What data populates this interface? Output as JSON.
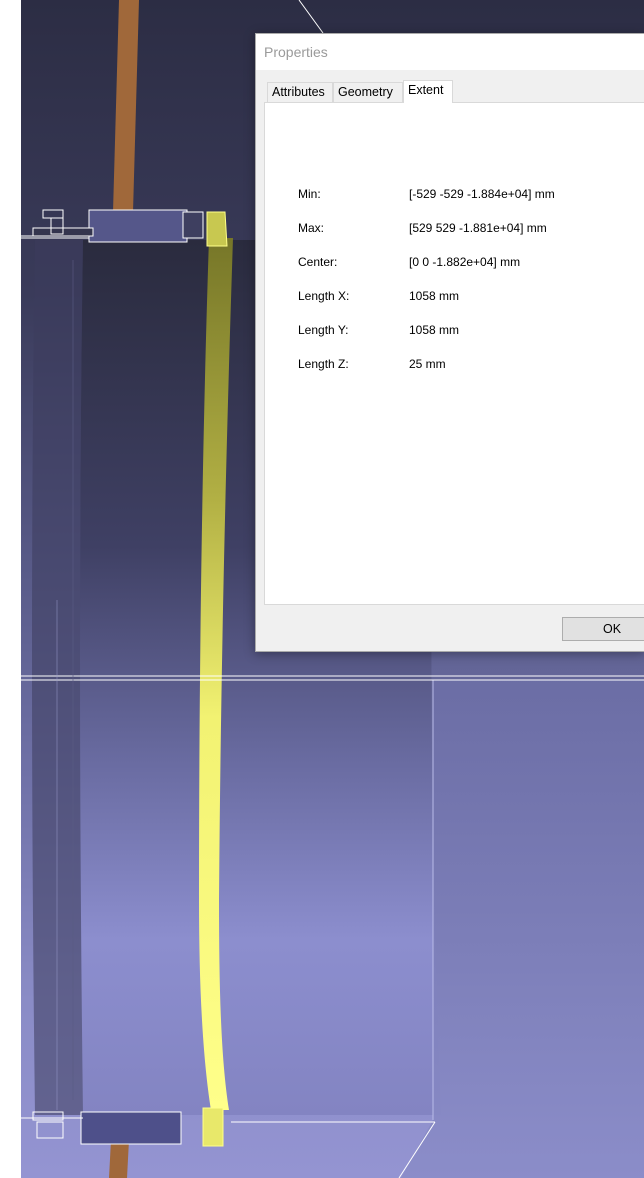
{
  "dialog": {
    "title": "Properties",
    "tabs": [
      {
        "label": "Attributes",
        "active": false
      },
      {
        "label": "Geometry",
        "active": false
      },
      {
        "label": "Extent",
        "active": true
      }
    ],
    "extent": {
      "rows": [
        {
          "label": "Min:",
          "value": "[-529 -529 -1.884e+04] mm"
        },
        {
          "label": "Max:",
          "value": "[529 529 -1.881e+04] mm"
        },
        {
          "label": "Center:",
          "value": "[0 0 -1.882e+04] mm"
        },
        {
          "label": "Length X:",
          "value": "1058 mm"
        },
        {
          "label": "Length Y:",
          "value": "1058 mm"
        },
        {
          "label": "Length Z:",
          "value": "25 mm"
        }
      ]
    },
    "ok_label": "OK"
  },
  "viewport": {
    "colors": {
      "background_top": "#2c2d44",
      "background_bottom": "#9494d2",
      "selected_part": "#ffff8a",
      "rod": "#a0683a"
    }
  }
}
